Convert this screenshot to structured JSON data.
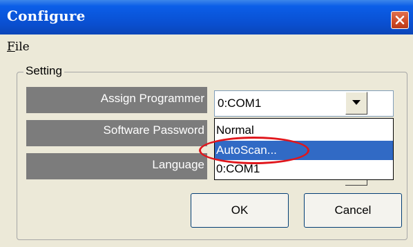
{
  "window": {
    "title": "Configure",
    "close_icon": "close-icon",
    "accent_color": "#0a4fd0",
    "close_color": "#cf4b26"
  },
  "menu": {
    "file_mnemonic": "F",
    "file_rest": "ile"
  },
  "setting": {
    "group_label": "Setting",
    "rows": [
      {
        "label": "Assign Programmer"
      },
      {
        "label": "Software Password"
      },
      {
        "label": "Language"
      }
    ],
    "programmer_combo": {
      "value": "0:COM1",
      "open": true,
      "options": [
        "Normal",
        "AutoScan...",
        "0:COM1"
      ],
      "selected_option": "AutoScan...",
      "highlight_color": "#316ac5"
    },
    "annotation_color": "#e0161c"
  },
  "buttons": {
    "ok": "OK",
    "cancel": "Cancel"
  }
}
